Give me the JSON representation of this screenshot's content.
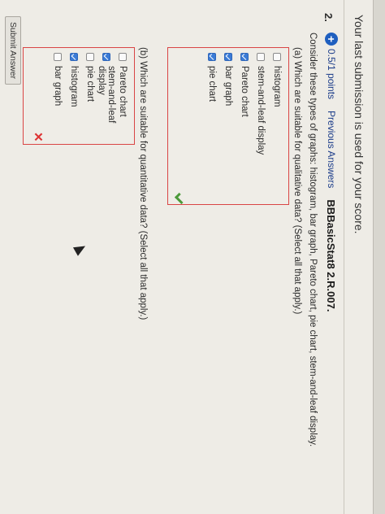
{
  "last_submission_note": "Your last submission is used for your score.",
  "question": {
    "number": "2.",
    "points": "0.5/1 points",
    "previous_answers": "Previous Answers",
    "id": "BBBasicStat8 2.R.007.",
    "stem": "Consider these types of graphs: histogram, bar graph, Pareto chart, pie chart, stem-and-leaf display.",
    "part_a": {
      "prompt": "(a) Which are suitable for qualitative data? (Select all that apply.)",
      "options": [
        {
          "label": "histogram",
          "checked": false
        },
        {
          "label": "stem-and-leaf display",
          "checked": false
        },
        {
          "label": "Pareto chart",
          "checked": true
        },
        {
          "label": "bar graph",
          "checked": true
        },
        {
          "label": "pie chart",
          "checked": true
        }
      ],
      "result": "correct"
    },
    "part_b": {
      "prompt": "(b) Which are suitable for quantitative data? (Select all that apply.)",
      "options": [
        {
          "label": "Pareto chart",
          "checked": false
        },
        {
          "label": "stem-and-leaf display",
          "checked": true
        },
        {
          "label": "pie chart",
          "checked": false
        },
        {
          "label": "histogram",
          "checked": true
        },
        {
          "label": "bar graph",
          "checked": false
        }
      ],
      "result": "incorrect"
    }
  },
  "submit_label": "Submit Answer",
  "colors": {
    "accent_blue": "#1f5fbf",
    "checkbox_checked": "#3b7bd6",
    "error_red": "#d94545",
    "correct_green": "#4c9a3a"
  },
  "icons": [
    "plus-circle-icon",
    "checkmark-icon",
    "x-icon",
    "mouse-cursor-icon"
  ]
}
